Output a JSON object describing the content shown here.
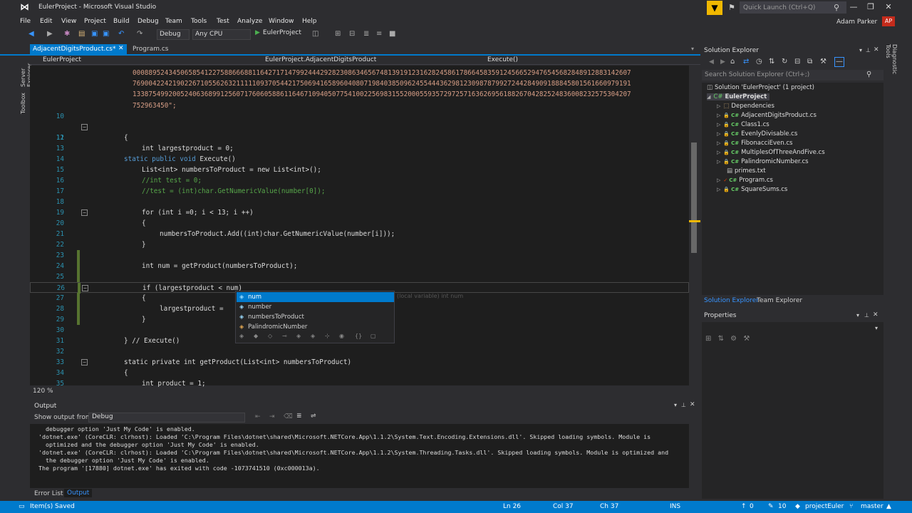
{
  "window": {
    "title": "EulerProject - Microsoft Visual Studio",
    "quick_launch_placeholder": "Quick Launch (Ctrl+Q)",
    "user_name": "Adam Parker",
    "user_initials": "AP"
  },
  "menu": [
    "File",
    "Edit",
    "View",
    "Project",
    "Build",
    "Debug",
    "Team",
    "Tools",
    "Test",
    "Analyze",
    "Window",
    "Help"
  ],
  "toolbar": {
    "config": "Debug",
    "platform": "Any CPU",
    "run_target": "EulerProject"
  },
  "tabs": {
    "active": "AdjacentDigitsProduct.cs*",
    "second": "Program.cs"
  },
  "navbar": {
    "project": "EulerProject",
    "class": "EulerProject.AdjacentDigitsProduct",
    "member": "Execute()"
  },
  "side_labels": {
    "left_top": "Server Explorer",
    "left_bottom": "Toolbox",
    "right": "Diagnostic Tools"
  },
  "code": {
    "number_lines": [
      "00088952434506585412275886668811642717147992444292823086346567481391912316282458617866458359124566529476545682848912883142607",
      "76900422421902267105562632111110937054421750694165896040807198403850962455444362981230987879927244284909188845801561660979191",
      "13387549920052406368991256071760605886116467109405077541002256983155200055935729725716362695618826704282524836008232575304207",
      "752963450\";"
    ],
    "lines": [
      {
        "n": "10",
        "text": ""
      },
      {
        "n": "11",
        "text": "static public void Execute()"
      },
      {
        "n": "12",
        "text": "{"
      },
      {
        "n": "13",
        "text": "int largestproduct = 0;"
      },
      {
        "n": "14",
        "text": ""
      },
      {
        "n": "15",
        "text": "List<int> numbersToProduct = new List<int>();"
      },
      {
        "n": "16",
        "text": "//int test = 0;"
      },
      {
        "n": "17",
        "text": "//test = (int)char.GetNumericValue(number[0]);"
      },
      {
        "n": "18",
        "text": ""
      },
      {
        "n": "19",
        "text": "for (int i =0; i < 13; i ++)"
      },
      {
        "n": "20",
        "text": "{"
      },
      {
        "n": "21",
        "text": "numbersToProduct.Add((int)char.GetNumericValue(number[i]));"
      },
      {
        "n": "22",
        "text": "}"
      },
      {
        "n": "23",
        "text": ""
      },
      {
        "n": "24",
        "text": "int num = getProduct(numbersToProduct);"
      },
      {
        "n": "25",
        "text": ""
      },
      {
        "n": "26",
        "text": "if (largestproduct < num)"
      },
      {
        "n": "27",
        "text": "{"
      },
      {
        "n": "28",
        "text": "largestproduct ="
      },
      {
        "n": "29",
        "text": "}"
      },
      {
        "n": "30",
        "text": ""
      },
      {
        "n": "31",
        "text": "} // Execute()"
      },
      {
        "n": "32",
        "text": ""
      },
      {
        "n": "33",
        "text": "static private int getProduct(List<int> numbersToProduct)"
      },
      {
        "n": "34",
        "text": "{"
      },
      {
        "n": "35",
        "text": "int product = 1;"
      }
    ]
  },
  "intellisense": {
    "items": [
      "num",
      "number",
      "numbersToProduct",
      "PalindromicNumber"
    ],
    "hint": "(local variable) int num"
  },
  "editor": {
    "zoom": "120 %"
  },
  "output": {
    "title": "Output",
    "show_output_from_label": "Show output from:",
    "show_output_from_value": "Debug",
    "lines": [
      "  debugger option 'Just My Code' is enabled.",
      "'dotnet.exe' (CoreCLR: clrhost): Loaded 'C:\\Program Files\\dotnet\\shared\\Microsoft.NETCore.App\\1.1.2\\System.Text.Encoding.Extensions.dll'. Skipped loading symbols. Module is",
      "  optimized and the debugger option 'Just My Code' is enabled.",
      "'dotnet.exe' (CoreCLR: clrhost): Loaded 'C:\\Program Files\\dotnet\\shared\\Microsoft.NETCore.App\\1.1.2\\System.Threading.Tasks.dll'. Skipped loading symbols. Module is optimized and",
      "  the debugger option 'Just My Code' is enabled.",
      "The program '[17880] dotnet.exe' has exited with code -1073741510 (0xc000013a)."
    ],
    "tabs": [
      "Error List",
      "Output"
    ]
  },
  "solution_explorer": {
    "title": "Solution Explorer",
    "search_placeholder": "Search Solution Explorer (Ctrl+;)",
    "solution": "Solution 'EulerProject' (1 project)",
    "project": "EulerProject",
    "items": [
      "Dependencies",
      "AdjacentDigitsProduct.cs",
      "Class1.cs",
      "EvenlyDivisable.cs",
      "FibonacciEven.cs",
      "MultiplesOfThreeAndFive.cs",
      "PalindromicNumber.cs",
      "primes.txt",
      "Program.cs",
      "SquareSums.cs"
    ],
    "tabs": [
      "Solution Explorer",
      "Team Explorer"
    ]
  },
  "properties": {
    "title": "Properties"
  },
  "statusbar": {
    "status": "Item(s) Saved",
    "ln": "Ln 26",
    "col": "Col 37",
    "ch": "Ch 37",
    "ins": "INS",
    "up": "0",
    "changes": "10",
    "repo": "projectEuler",
    "branch": "master"
  }
}
